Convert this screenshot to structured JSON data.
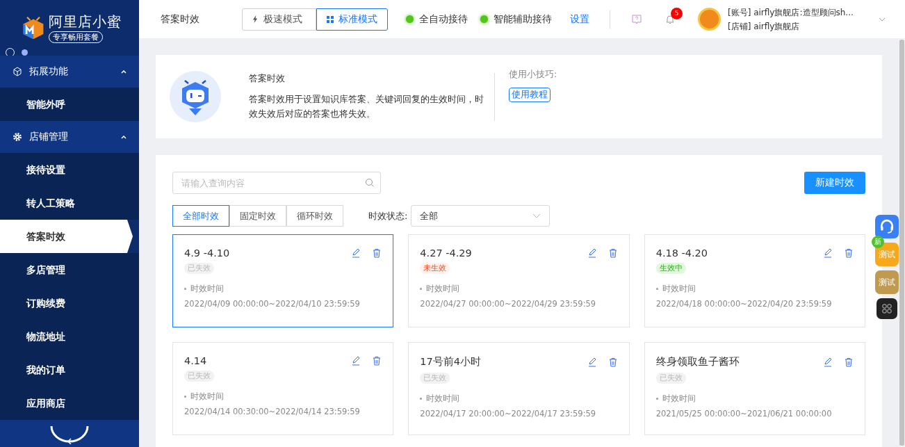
{
  "brand": {
    "name": "阿里店小蜜",
    "badge": "专享畅用套餐"
  },
  "sidebar": {
    "items": [
      {
        "label": "拓展功能",
        "kind": "group",
        "expanded": true,
        "children": [
          {
            "label": "智能外呼",
            "selected": false
          }
        ]
      },
      {
        "label": "店铺管理",
        "kind": "group",
        "expanded": true,
        "children": [
          {
            "label": "接待设置",
            "selected": false
          },
          {
            "label": "转人工策略",
            "selected": false
          },
          {
            "label": "答案时效",
            "selected": true
          },
          {
            "label": "多店管理",
            "selected": false
          },
          {
            "label": "订购续费",
            "selected": false
          },
          {
            "label": "物流地址",
            "selected": false
          },
          {
            "label": "我的订单",
            "selected": false
          },
          {
            "label": "应用商店",
            "selected": false
          }
        ]
      }
    ]
  },
  "header": {
    "title": "答案时效",
    "modes": [
      {
        "label": "极速模式",
        "kind": "fast",
        "selected": false
      },
      {
        "label": "标准模式",
        "kind": "standard",
        "selected": true
      }
    ],
    "statuses": [
      {
        "label": "全自动接待",
        "color": "#52c41a"
      },
      {
        "label": "智能辅助接待",
        "color": "#52c41a"
      }
    ],
    "settings_link": "设置",
    "notification_count": "5",
    "account": {
      "line_1": "[账号] airfly旗舰店:造型顾问sh...",
      "line_2": "[店铺] airfly旗舰店"
    }
  },
  "intro": {
    "title": "答案时效",
    "description": "答案时效用于设置知识库答案、关键词回复的生效时间，时效失效后对应的答案也将失效。",
    "tips_label": "使用小技巧:",
    "tutorial_link": "使用教程"
  },
  "toolbar": {
    "search_placeholder": "请输入查询内容",
    "new_button": "新建时效"
  },
  "filter_tabs": [
    {
      "label": "全部时效",
      "selected": true
    },
    {
      "label": "固定时效",
      "selected": false
    },
    {
      "label": "循环时效",
      "selected": false
    }
  ],
  "status_filter": {
    "label": "时效状态:",
    "value": "全部"
  },
  "rules": [
    {
      "name": "4.9 -4.10",
      "status": "已失效",
      "kind": "expired",
      "time_label": "时效时间",
      "time_range": "2022/04/09 00:00:00~2022/04/10 23:59:59",
      "selected": true
    },
    {
      "name": "4.27 -4.29",
      "status": "未生效",
      "kind": "pending",
      "time_label": "时效时间",
      "time_range": "2022/04/27 00:00:00~2022/04/29 23:59:59",
      "selected": false
    },
    {
      "name": "4.18 -4.20",
      "status": "生效中",
      "kind": "active",
      "time_label": "时效时间",
      "time_range": "2022/04/18 00:00:00~2022/04/20 23:59:59",
      "selected": false
    },
    {
      "name": "4.14",
      "status": "已失效",
      "kind": "expired",
      "time_label": "时效时间",
      "time_range": "2022/04/14 00:30:00~2022/04/14 23:59:59",
      "selected": false
    },
    {
      "name": "17号前4小时",
      "status": "已失效",
      "kind": "expired",
      "time_label": "时效时间",
      "time_range": "2022/04/17 20:00:00~2022/04/17 23:59:59",
      "selected": false
    },
    {
      "name": "终身领取鱼子酱环",
      "status": "已失效",
      "kind": "expired",
      "time_label": "时效时间",
      "time_range": "2021/05/25 00:00:00~2021/06/21 00:00:00",
      "selected": false
    }
  ],
  "float_buttons": [
    {
      "kind": "support"
    },
    {
      "kind": "test",
      "label": "测试",
      "badge": "新",
      "color": "#f7a81b"
    },
    {
      "kind": "test",
      "label": "测试",
      "color": "#c09a4e"
    },
    {
      "kind": "apps"
    }
  ]
}
